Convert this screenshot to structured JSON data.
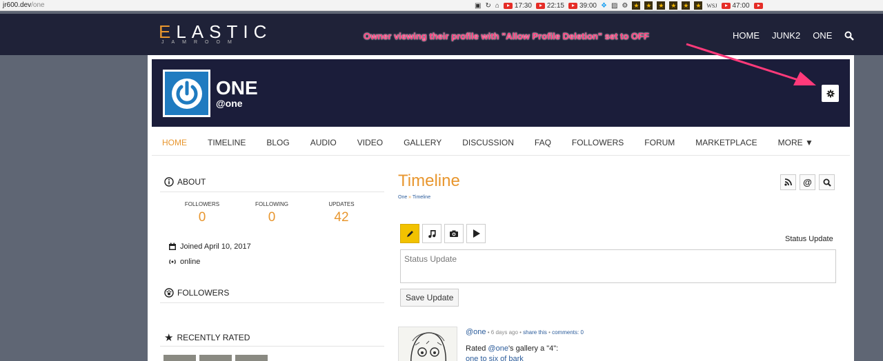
{
  "browser": {
    "url_host": "jr600.dev",
    "url_path": "/one",
    "toolbar_items": [
      "17:30",
      "22:15",
      "39:00",
      "WSJ",
      "47:00"
    ]
  },
  "site": {
    "logo_main": "LASTIC",
    "logo_first": "E",
    "logo_sub": "JAMROOM",
    "nav": [
      "HOME",
      "JUNK2",
      "ONE"
    ],
    "accent": "#e8962e",
    "header_bg": "#1f2238"
  },
  "annotation": "Owner viewing their profile with \"Allow Profile Deletion\" set to OFF",
  "profile": {
    "name": "ONE",
    "handle": "@one"
  },
  "profile_nav": [
    {
      "label": "HOME",
      "active": true
    },
    {
      "label": "TIMELINE"
    },
    {
      "label": "BLOG"
    },
    {
      "label": "AUDIO"
    },
    {
      "label": "VIDEO"
    },
    {
      "label": "GALLERY"
    },
    {
      "label": "DISCUSSION"
    },
    {
      "label": "FAQ"
    },
    {
      "label": "FOLLOWERS"
    },
    {
      "label": "FORUM"
    },
    {
      "label": "MARKETPLACE"
    },
    {
      "label": "MORE ▼"
    }
  ],
  "about": {
    "title": "ABOUT",
    "stats": [
      {
        "label": "FOLLOWERS",
        "value": "0"
      },
      {
        "label": "FOLLOWING",
        "value": "0"
      },
      {
        "label": "UPDATES",
        "value": "42"
      }
    ],
    "joined": "Joined April 10, 2017",
    "status": "online"
  },
  "followers_title": "FOLLOWERS",
  "recently_rated_title": "RECENTLY RATED",
  "timeline": {
    "title": "Timeline",
    "breadcrumb_root": "One",
    "breadcrumb_sep": " » ",
    "breadcrumb_current": "Timeline",
    "status_label": "Status Update",
    "input_placeholder": "Status Update",
    "save_label": "Save Update"
  },
  "post": {
    "user": "@one",
    "sep": " • ",
    "time": "6 days ago",
    "share": "share this",
    "comments": "comments: 0",
    "text_pre": "Rated ",
    "text_user": "@one",
    "text_post": "'s gallery a \"4\":",
    "link": "one to six of bark"
  }
}
